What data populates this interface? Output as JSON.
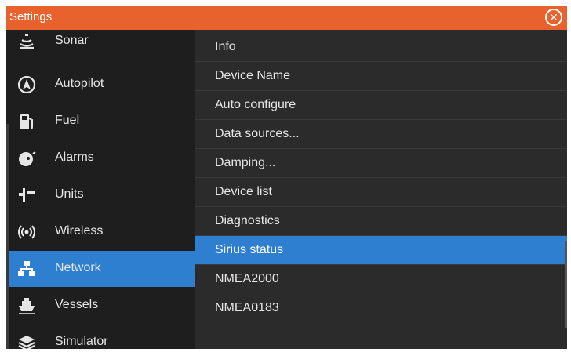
{
  "window": {
    "title": "Settings"
  },
  "sidebar": {
    "items": [
      {
        "label": "Sonar",
        "icon": "sonar-icon"
      },
      {
        "label": "Autopilot",
        "icon": "autopilot-icon"
      },
      {
        "label": "Fuel",
        "icon": "fuel-icon"
      },
      {
        "label": "Alarms",
        "icon": "alarm-icon"
      },
      {
        "label": "Units",
        "icon": "units-icon"
      },
      {
        "label": "Wireless",
        "icon": "wireless-icon"
      },
      {
        "label": "Network",
        "icon": "network-icon",
        "active": true
      },
      {
        "label": "Vessels",
        "icon": "vessels-icon"
      },
      {
        "label": "Simulator",
        "icon": "simulator-icon"
      }
    ]
  },
  "network_menu": {
    "items": [
      "Info",
      "Device Name",
      "Auto configure",
      "Data sources...",
      "Damping...",
      "Device list",
      "Diagnostics",
      "Sirius status",
      "NMEA2000",
      "NMEA0183"
    ],
    "selected": "Sirius status"
  },
  "colors": {
    "titlebar": "#e8622d",
    "accent": "#2f7fd0",
    "background": "#2b2b2b",
    "sidebar": "#1e1e1e"
  }
}
